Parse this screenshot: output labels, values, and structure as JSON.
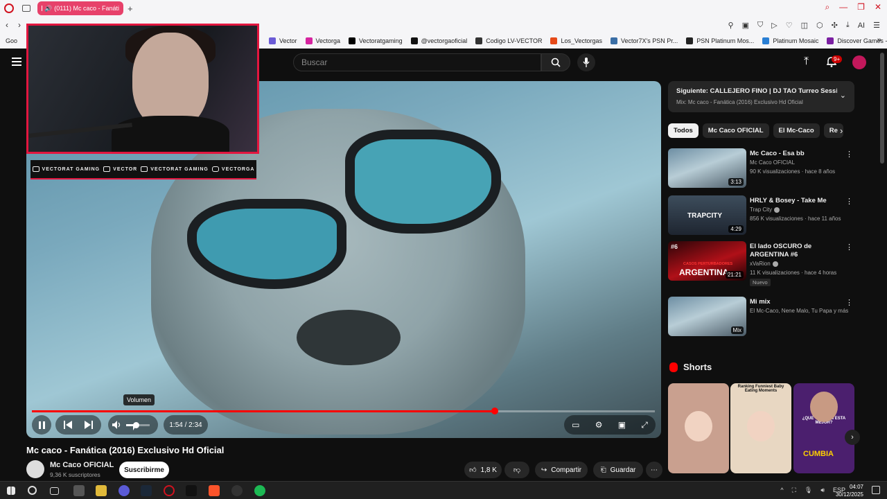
{
  "browser": {
    "tab_title": "(0111) Mc caco - Fanáti",
    "bookmarks_first": "Goo",
    "bookmarks": [
      {
        "label": "Vector",
        "color": "#6b5bd6"
      },
      {
        "label": "Vectorga",
        "color": "#d6249f"
      },
      {
        "label": "Vectoratgaming",
        "color": "#000000"
      },
      {
        "label": "@vectorgaoficial",
        "color": "#111111"
      },
      {
        "label": "Codigo LV-VECTOR",
        "color": "#333333"
      },
      {
        "label": "Los_Vectorgas",
        "color": "#e64a19"
      },
      {
        "label": "Vector7X's PSN Pr...",
        "color": "#3a6ea5"
      },
      {
        "label": "PSN Platinum Mos...",
        "color": "#222222"
      },
      {
        "label": "Platinum Mosaic",
        "color": "#2a7fd4"
      },
      {
        "label": "Discover Games -...",
        "color": "#7b1fa2"
      }
    ],
    "ext_ai": "AI"
  },
  "header": {
    "search_placeholder": "Buscar",
    "notif_badge": "9+"
  },
  "overlay": {
    "social": [
      "VECTORAT GAMING",
      "VECTOR",
      "VECTORAT GAMING",
      "VECTORGA"
    ]
  },
  "player": {
    "progress": 0.743,
    "volume_level": 0.4,
    "tooltip": "Volumen",
    "time": "1:54 / 2:34"
  },
  "video": {
    "title": "Mc caco - Fanática (2016) Exclusivo Hd Oficial",
    "channel": "Mc Caco OFICIAL",
    "subs": "9,36 K suscriptores",
    "subscribe": "Suscribirme",
    "likes": "1,8 K",
    "share": "Compartir",
    "save": "Guardar"
  },
  "sidebar": {
    "next_title": "Siguiente: CALLEJERO FINO | DJ TAO Turreo Sessi...",
    "next_sub": "Mix: Mc caco - Fanática (2016) Exclusivo Hd Oficial",
    "chips": [
      "Todos",
      "Mc Caco OFICIAL",
      "El Mc-Caco",
      "Re"
    ],
    "recs": [
      {
        "title": "Mc Caco - Esa bb",
        "channel": "Mc Caco OFICIAL",
        "meta": "90 K visualizaciones · hace 8 años",
        "dur": "3:13",
        "verified": false,
        "nuevo": ""
      },
      {
        "title": "HRLY & Bosey - Take Me",
        "channel": "Trap City",
        "meta": "856 K visualizaciones · hace 11 años",
        "dur": "4:29",
        "verified": true,
        "nuevo": "",
        "thumb_text": "TRAPCITY"
      },
      {
        "title": "El lado OSCURO de ARGENTINA #6",
        "channel": "xVaRion",
        "meta": "11 K visualizaciones · hace 4 horas",
        "dur": "21:21",
        "verified": true,
        "nuevo": "Nuevo",
        "thumb_text": "ARGENTINA",
        "thumb_tag": "#6",
        "thumb_sub": "CASOS PERTURBADORES"
      },
      {
        "title": "Mi mix",
        "channel": "El Mc-Caco, Nene Malo, Tu Papa y más",
        "meta": "",
        "dur": "Mix",
        "verified": false,
        "nuevo": ""
      }
    ],
    "shorts_title": "Shorts",
    "shorts": [
      {
        "color": "#c9a08f",
        "text": ""
      },
      {
        "color": "#e8d7c2",
        "text": "Ranking Funniest Baby Eating Moments"
      },
      {
        "color": "#4b1f6e",
        "text": "¿QUE VERSION ESTA MEJOR?",
        "sub": "CUMBIA"
      }
    ]
  },
  "taskbar": {
    "lang": "ESP",
    "time": "04:07",
    "date": "30/12/2025"
  }
}
